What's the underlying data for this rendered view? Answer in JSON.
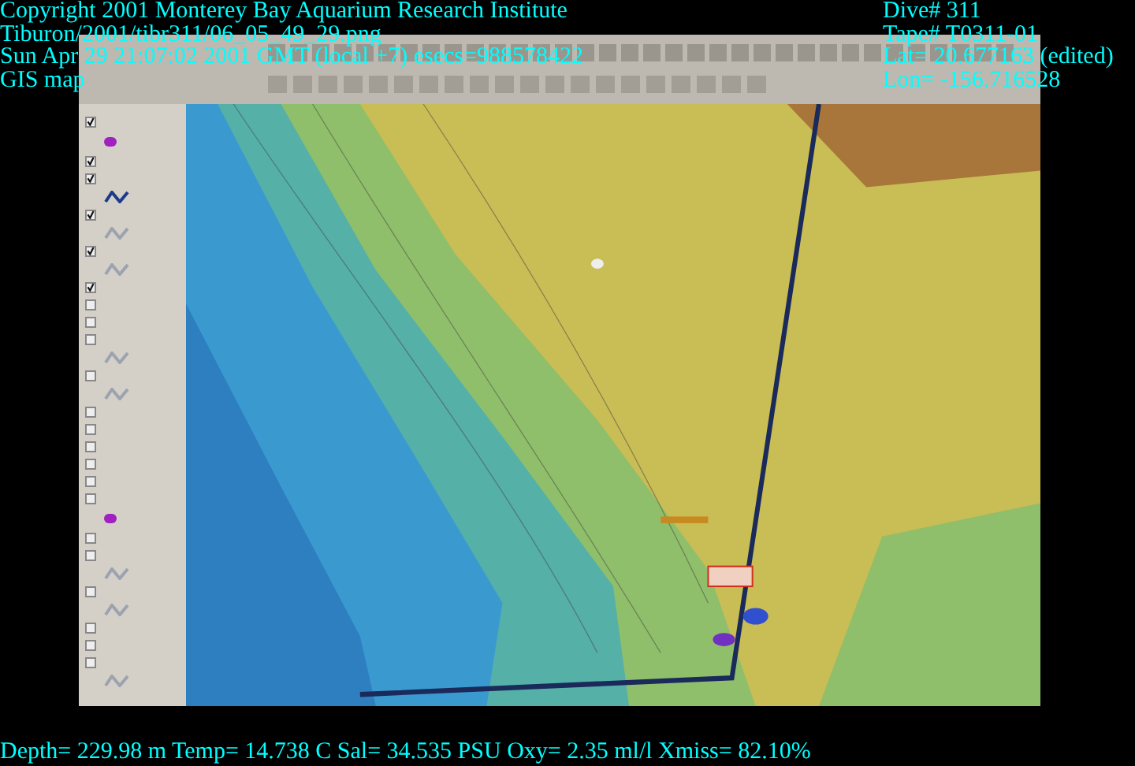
{
  "overlay_top_left": [
    "Copyright 2001 Monterey Bay Aquarium Research Institute",
    "Tiburon/2001/tibr311/06_05_49_29.png",
    "Sun Apr 29 21:07:02 2001 GMT (local +7)  esecs=988578422",
    "GIS map"
  ],
  "overlay_top_right": [
    "Dive# 311",
    "Tape# T0311-01",
    "Lat= 20.677163 (edited)",
    "Lon= -156.716528"
  ],
  "overlay_bottom": "Depth= 229.98 m  Temp= 14.738 C  Sal= 34.535 PSU  Oxy= 2.35 ml/l  Xmiss= 82.10%",
  "legend": [
    {
      "checked": true,
      "kind": "dot"
    },
    {
      "checked": true,
      "kind": "plain"
    },
    {
      "checked": true,
      "kind": "line",
      "color": "#1e3a8a"
    },
    {
      "checked": true,
      "kind": "line",
      "color": "#9ca3af"
    },
    {
      "checked": true,
      "kind": "line",
      "color": "#9ca3af"
    },
    {
      "checked": true,
      "kind": "plain"
    },
    {
      "checked": false,
      "kind": "plain"
    },
    {
      "checked": false,
      "kind": "plain"
    },
    {
      "checked": false,
      "kind": "line",
      "color": "#9ca3af"
    },
    {
      "checked": false,
      "kind": "line",
      "color": "#9ca3af"
    },
    {
      "checked": false,
      "kind": "plain"
    },
    {
      "checked": false,
      "kind": "plain"
    },
    {
      "checked": false,
      "kind": "plain"
    },
    {
      "checked": false,
      "kind": "plain"
    },
    {
      "checked": false,
      "kind": "plain"
    },
    {
      "checked": false,
      "kind": "dot"
    },
    {
      "checked": false,
      "kind": "plain"
    },
    {
      "checked": false,
      "kind": "line",
      "color": "#9ca3af"
    },
    {
      "checked": false,
      "kind": "line",
      "color": "#9ca3af"
    },
    {
      "checked": false,
      "kind": "plain"
    },
    {
      "checked": false,
      "kind": "plain"
    },
    {
      "checked": false,
      "kind": "line",
      "color": "#9ca3af"
    }
  ]
}
